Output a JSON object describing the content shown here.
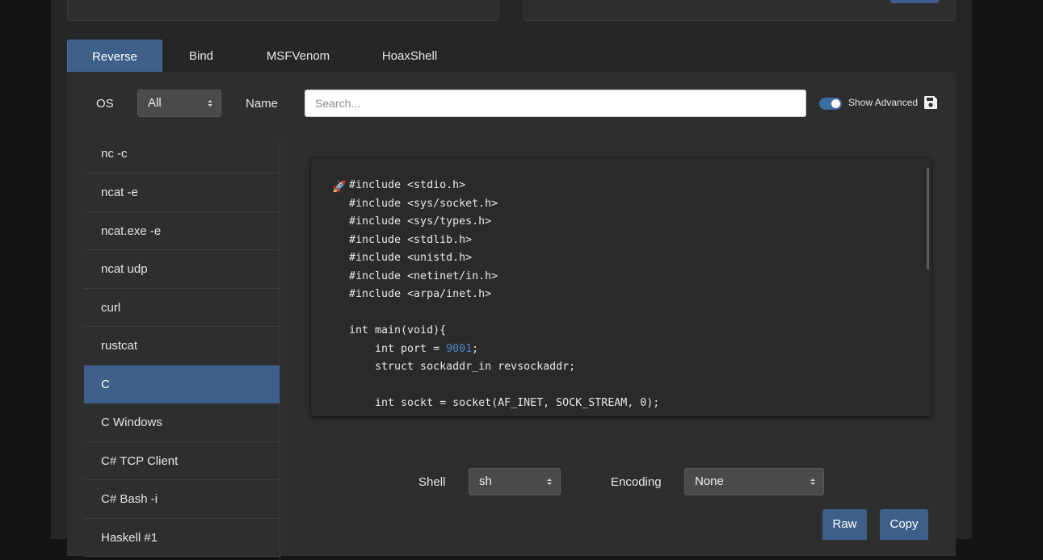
{
  "tabs": [
    {
      "label": "Reverse",
      "active": true
    },
    {
      "label": "Bind",
      "active": false
    },
    {
      "label": "MSFVenom",
      "active": false
    },
    {
      "label": "HoaxShell",
      "active": false
    }
  ],
  "filters": {
    "os_label": "OS",
    "os_value": "All",
    "name_label": "Name",
    "search_placeholder": "Search...",
    "search_value": "",
    "show_advanced_label": "Show Advanced",
    "show_advanced_on": true
  },
  "shell_list": {
    "items": [
      "nc -c",
      "ncat -e",
      "ncat.exe -e",
      "ncat udp",
      "curl",
      "rustcat",
      "C",
      "C Windows",
      "C# TCP Client",
      "C# Bash -i",
      "Haskell #1"
    ],
    "selected": "C"
  },
  "code": {
    "icon": "rocket-icon",
    "lines": [
      "#include <stdio.h>",
      "#include <sys/socket.h>",
      "#include <sys/types.h>",
      "#include <stdlib.h>",
      "#include <unistd.h>",
      "#include <netinet/in.h>",
      "#include <arpa/inet.h>",
      "",
      "int main(void){",
      "    int port = ",
      "    struct sockaddr_in revsockaddr;",
      "",
      "    int sockt = socket(AF_INET, SOCK_STREAM, 0);"
    ],
    "port": "9001",
    "port_line_suffix": ";"
  },
  "options": {
    "shell_label": "Shell",
    "shell_value": "sh",
    "encoding_label": "Encoding",
    "encoding_value": "None"
  },
  "buttons": {
    "raw": "Raw",
    "copy": "Copy"
  },
  "colors": {
    "accent": "#3d5f8a",
    "background": "#262626",
    "panel": "#2e2e2e",
    "port_highlight": "#4a8ad0"
  }
}
